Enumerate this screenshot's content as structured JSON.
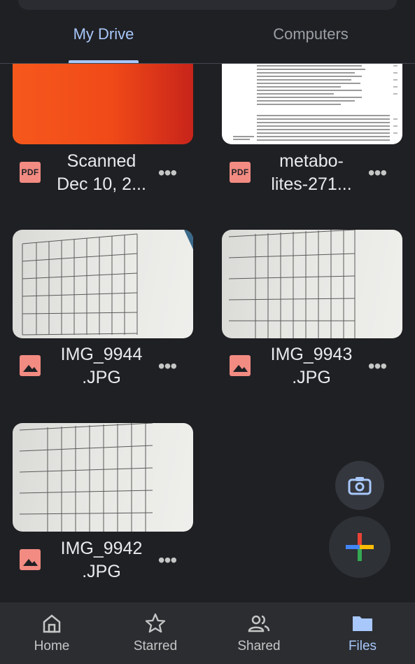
{
  "tabs": [
    {
      "label": "My Drive",
      "active": true
    },
    {
      "label": "Computers",
      "active": false
    }
  ],
  "files": [
    {
      "name_line1": "Scanned",
      "name_line2": "Dec 10, 2...",
      "type": "pdf",
      "badge": "PDF",
      "thumb": "orange-scan"
    },
    {
      "name_line1": "metabo-",
      "name_line2": "lites-271...",
      "type": "pdf",
      "badge": "PDF",
      "thumb": "document"
    },
    {
      "name_line1": "IMG_9944",
      "name_line2": ".JPG",
      "type": "image",
      "thumb": "photo"
    },
    {
      "name_line1": "IMG_9943",
      "name_line2": ".JPG",
      "type": "image",
      "thumb": "photo"
    },
    {
      "name_line1": "IMG_9942",
      "name_line2": ".JPG",
      "type": "image",
      "thumb": "photo"
    }
  ],
  "more_label": "•••",
  "fabs": {
    "camera_icon": "camera-icon",
    "add_icon": "plus-icon"
  },
  "bottom_nav": [
    {
      "label": "Home",
      "icon": "home-icon",
      "active": false
    },
    {
      "label": "Starred",
      "icon": "star-icon",
      "active": false
    },
    {
      "label": "Shared",
      "icon": "people-icon",
      "active": false
    },
    {
      "label": "Files",
      "icon": "folder-icon",
      "active": true
    }
  ],
  "colors": {
    "background": "#1f2024",
    "accent": "#a8c7fa",
    "file_badge": "#f28b82",
    "nav_bg": "#2b2d31"
  }
}
